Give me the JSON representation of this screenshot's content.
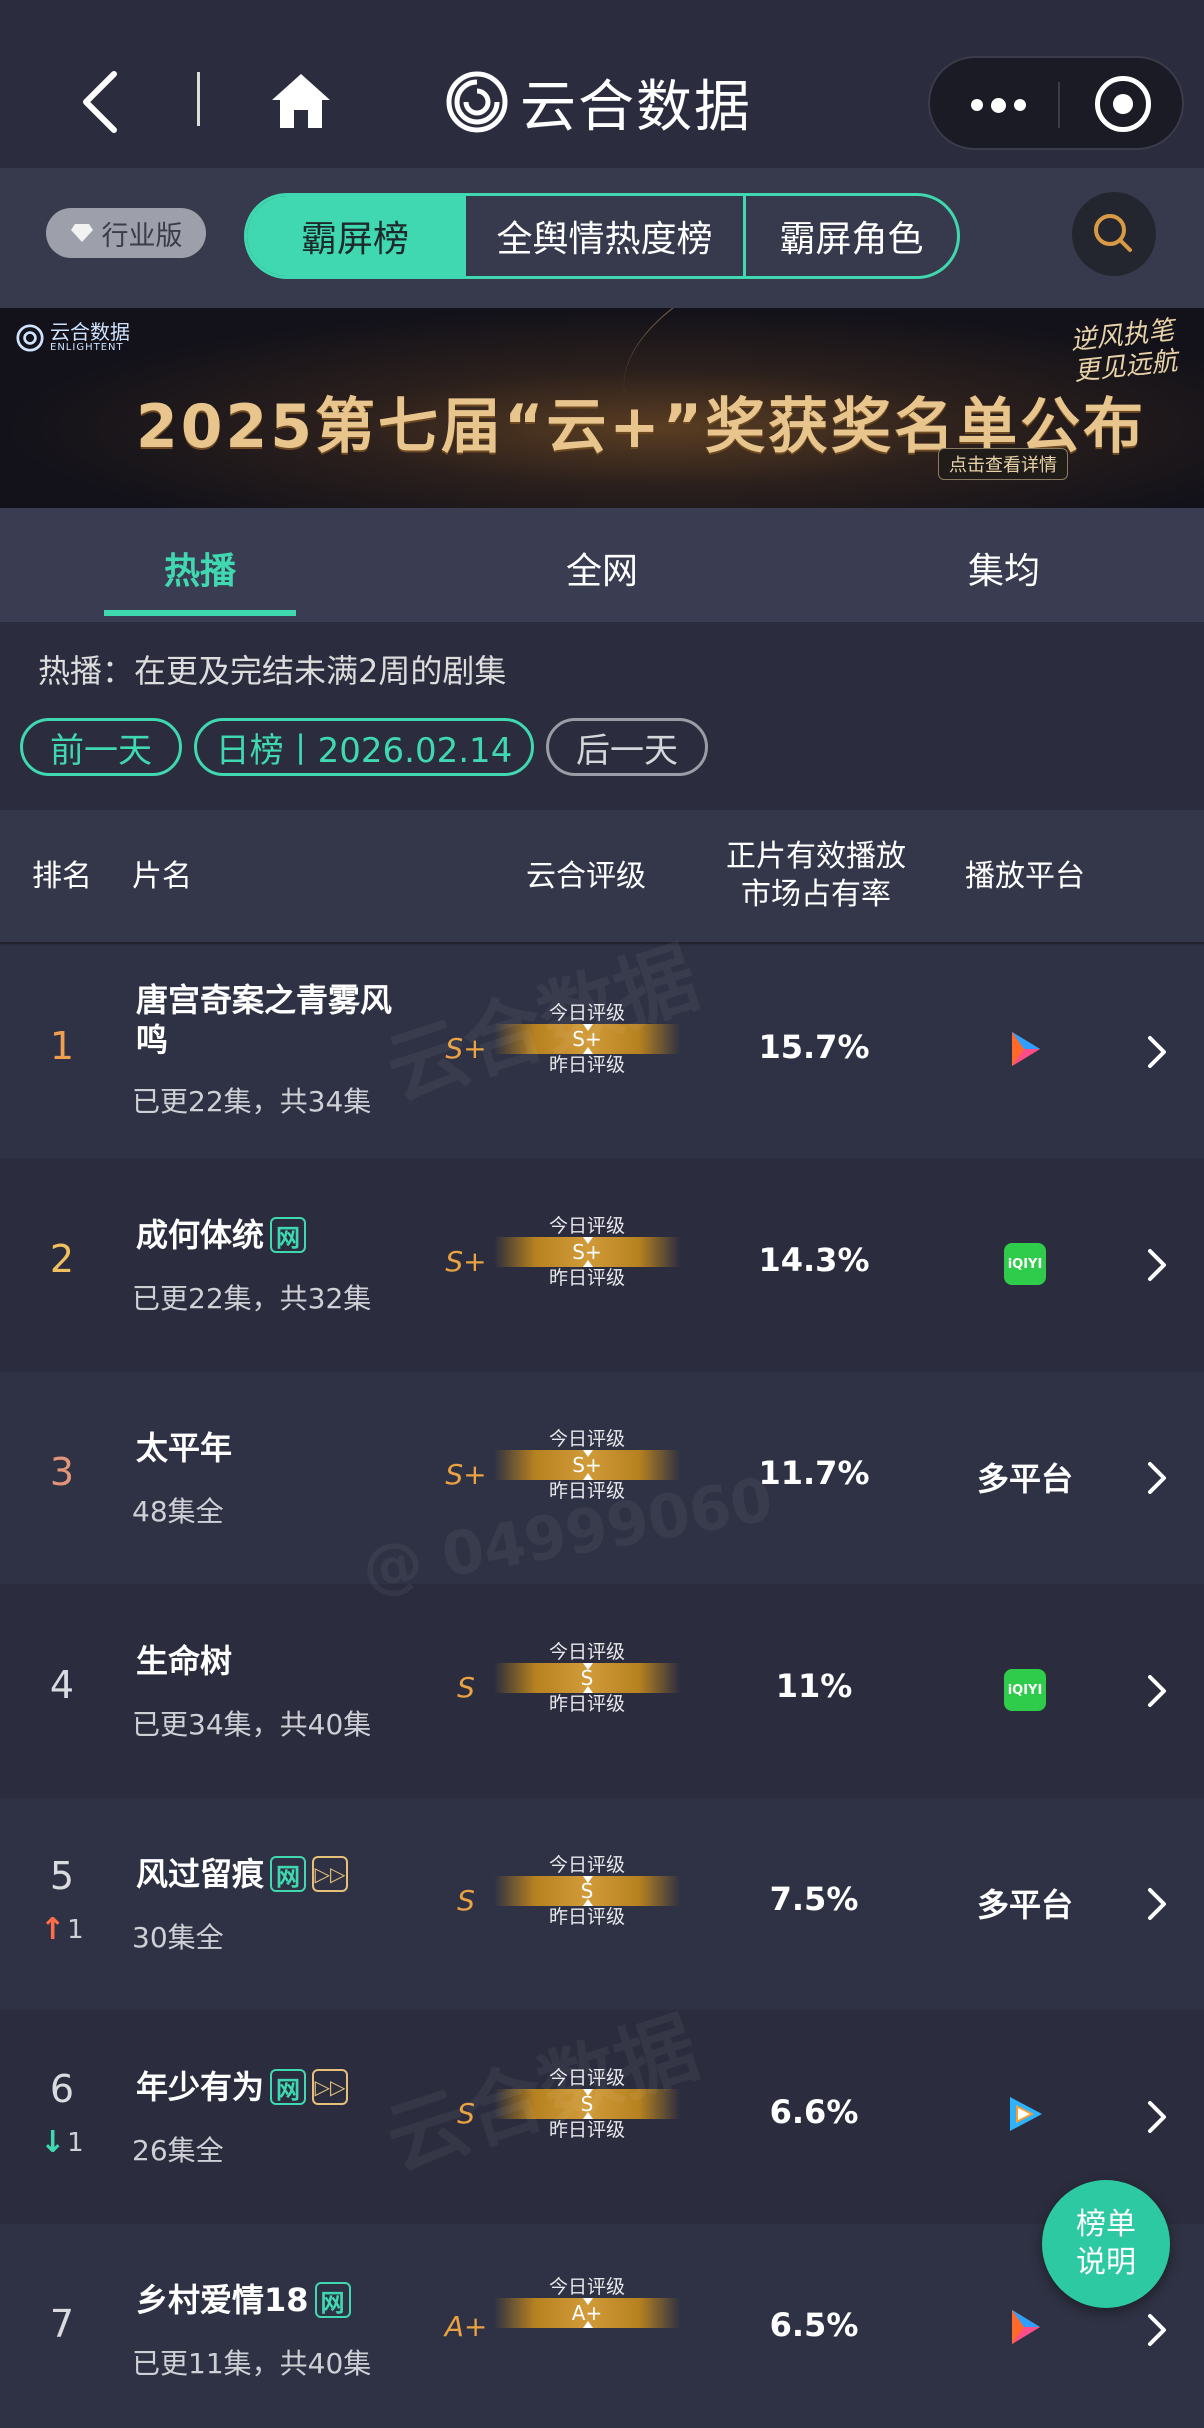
{
  "app": {
    "title": "云合数据"
  },
  "nav": {
    "back": "back",
    "home": "home"
  },
  "header": {
    "industry_label": "行业版",
    "tabs": [
      "霸屏榜",
      "全舆情热度榜",
      "霸屏角色"
    ],
    "active_tab": "霸屏榜"
  },
  "banner": {
    "logo_text": "云合数据",
    "logo_sub": "ENLIGHTENT",
    "title": "2025第七届“云+”奖获奖名单公布",
    "slogan": "逆风执笔 更见远航",
    "cta": "点击查看详情"
  },
  "subtabs": [
    "热播",
    "全网",
    "集均"
  ],
  "subtabs_active": "热播",
  "description": "热播：在更及完结未满2周的剧集",
  "date_bar": {
    "prev": "前一天",
    "current": "日榜丨2026.02.14",
    "next": "后一天"
  },
  "table": {
    "headers": {
      "rank": "排名",
      "name": "片名",
      "rating": "云合评级",
      "share_line1": "正片有效播放",
      "share_line2": "市场占有率",
      "platform": "播放平台"
    },
    "gauge_top_label": "今日评级",
    "gauge_bottom_label": "昨日评级",
    "rows": [
      {
        "rank": "1",
        "title": "唐宫奇案之青雾风鸣",
        "tags": [],
        "episodes": "已更22集，共34集",
        "grade": "S+",
        "gauge": "S+",
        "share": "15.7%",
        "platform": "",
        "platform_icon": "youku-icon"
      },
      {
        "rank": "2",
        "title": "成何体统",
        "tags": [
          "网"
        ],
        "episodes": "已更22集，共32集",
        "grade": "S+",
        "gauge": "S+",
        "share": "14.3%",
        "platform": "",
        "platform_icon": "iqiyi-icon",
        "platform_icon_text": "iQIYI"
      },
      {
        "rank": "3",
        "title": "太平年",
        "tags": [],
        "episodes": "48集全",
        "grade": "S+",
        "gauge": "S+",
        "share": "11.7%",
        "platform": "多平台",
        "platform_icon": ""
      },
      {
        "rank": "4",
        "title": "生命树",
        "tags": [],
        "episodes": "已更34集，共40集",
        "grade": "S",
        "gauge": "S",
        "share": "11%",
        "platform": "",
        "platform_icon": "iqiyi-icon",
        "platform_icon_text": "iQIYI"
      },
      {
        "rank": "5",
        "rank_change": "1",
        "rank_dir": "up",
        "title": "风过留痕",
        "tags": [
          "网",
          "▷▷"
        ],
        "episodes": "30集全",
        "grade": "S",
        "gauge": "S",
        "share": "7.5%",
        "platform": "多平台",
        "platform_icon": ""
      },
      {
        "rank": "6",
        "rank_change": "1",
        "rank_dir": "down",
        "title": "年少有为",
        "tags": [
          "网",
          "▷▷"
        ],
        "episodes": "26集全",
        "grade": "S",
        "gauge": "S",
        "share": "6.6%",
        "platform": "",
        "platform_icon": "tencent-video-icon"
      },
      {
        "rank": "7",
        "title": "乡村爱情18",
        "tags": [
          "网"
        ],
        "episodes": "已更11集，共40集",
        "grade": "A+",
        "gauge": "A+",
        "share": "6.5%",
        "platform": "",
        "platform_icon": "youku-icon"
      }
    ]
  },
  "float_button": {
    "line1": "榜单",
    "line2": "说明"
  },
  "watermarks": {
    "brand": "云合数据",
    "brand_en": "ENLIGHTENT",
    "handle": "@ 04999060"
  },
  "colors": {
    "accent": "#3fd8b0",
    "gold": "#eaa243",
    "background": "#2b2d3e"
  }
}
